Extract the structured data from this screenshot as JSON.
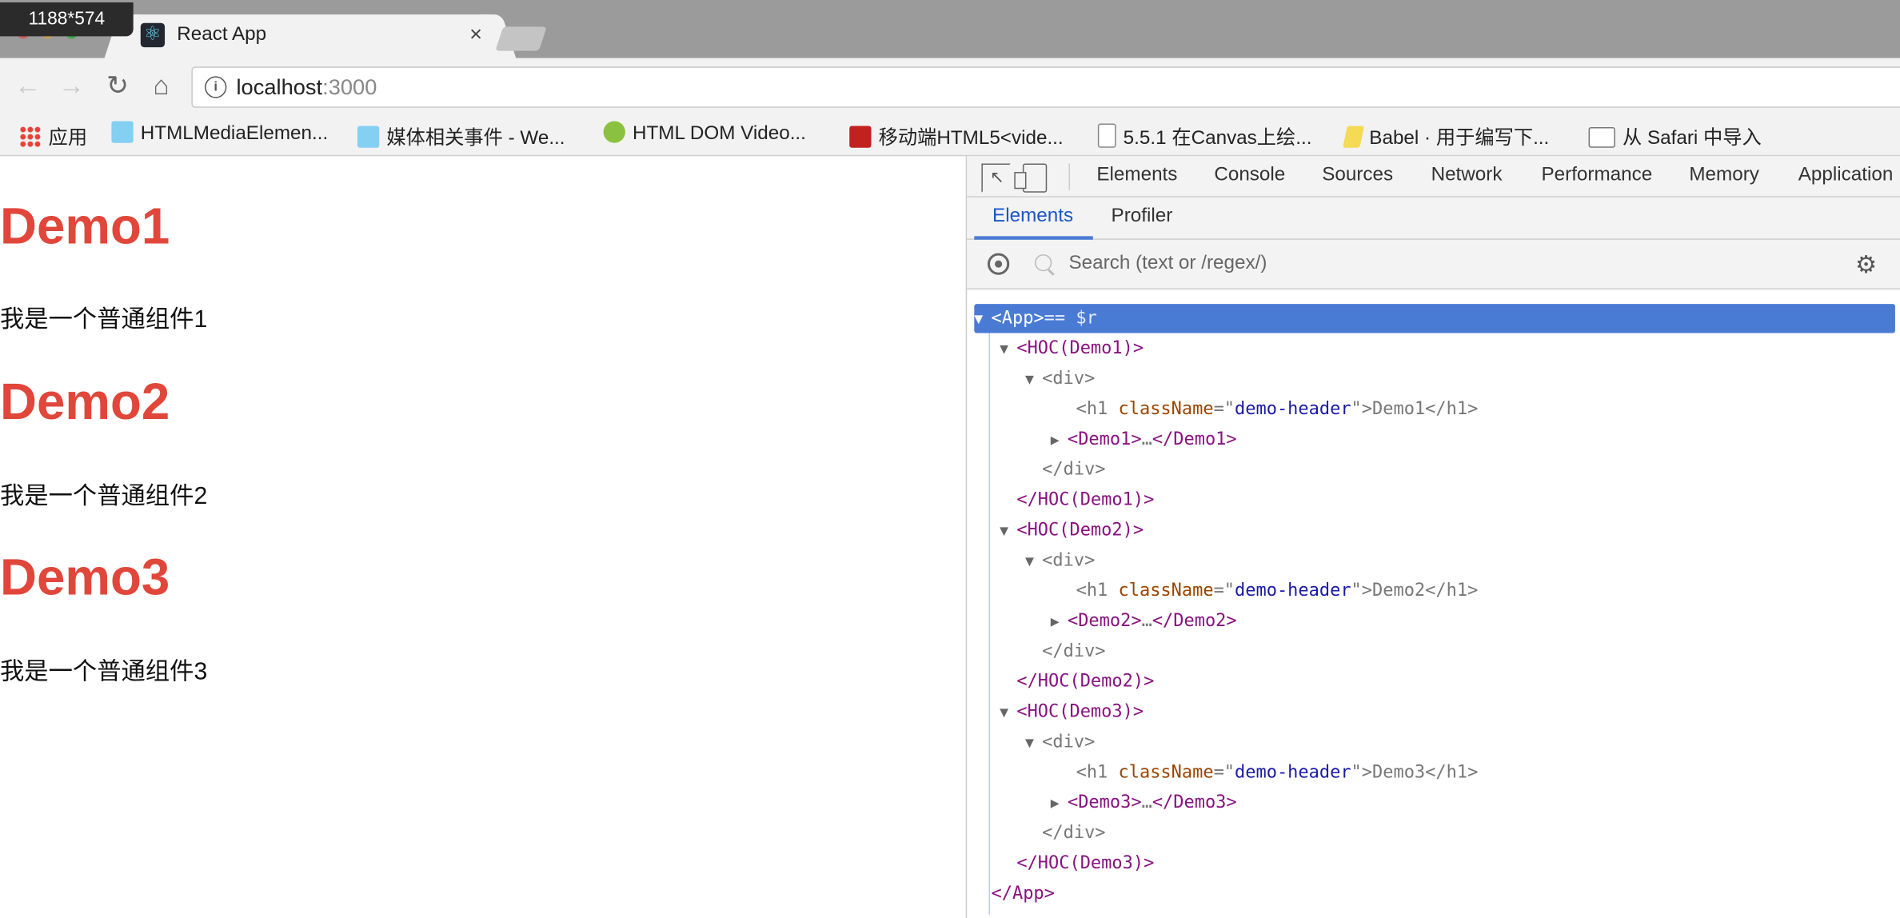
{
  "badge": "1188*574",
  "tab": {
    "title": "React App",
    "close": "×"
  },
  "nav": {
    "back": "←",
    "forward": "→",
    "reload": "↻",
    "home": "⌂"
  },
  "address": {
    "host": "localhost",
    "port": ":3000"
  },
  "bookmarks": [
    {
      "label": "应用",
      "icon": "apps-grid-icon",
      "color": "#e94335"
    },
    {
      "label": "HTMLMediaElemen...",
      "icon": "mdn-dino-icon",
      "color": "#83d0f2"
    },
    {
      "label": "媒体相关事件 - We...",
      "icon": "mdn-dino-icon",
      "color": "#83d0f2"
    },
    {
      "label": "HTML DOM Video...",
      "icon": "w3c-code-icon",
      "color": "#8ac13f"
    },
    {
      "label": "移动端HTML5<vide...",
      "icon": "csdn-icon",
      "color": "#c32020"
    },
    {
      "label": "5.5.1 在Canvas上绘...",
      "icon": "document-icon",
      "color": "#888888"
    },
    {
      "label": "Babel · 用于编写下...",
      "icon": "babel-icon",
      "color": "#f5da55"
    },
    {
      "label": "从 Safari 中导入",
      "icon": "folder-icon",
      "color": "#777777"
    }
  ],
  "page": {
    "items": [
      {
        "heading": "Demo1",
        "text": "我是一个普通组件1"
      },
      {
        "heading": "Demo2",
        "text": "我是一个普通组件2"
      },
      {
        "heading": "Demo3",
        "text": "我是一个普通组件3"
      }
    ]
  },
  "devtools": {
    "tabs": [
      "Elements",
      "Console",
      "Sources",
      "Network",
      "Performance",
      "Memory",
      "Application"
    ],
    "react_tabs": [
      "Elements",
      "Profiler"
    ],
    "search_placeholder": "Search (text or /regex/)",
    "tree": {
      "root_open": "<App>",
      "root_suffix": "== $r",
      "root_close": "</App>",
      "hocs": [
        {
          "open": "<HOC(Demo1)>",
          "div_open": "<div>",
          "h1_open": "<h1 ",
          "attr": "className",
          "eq": "=\"",
          "val": "demo-header",
          "h1_rest": "\">Demo1</h1>",
          "child_open": "<Demo1>",
          "ellipsis": "…",
          "child_close": "</Demo1>",
          "div_close": "</div>",
          "close": "</HOC(Demo1)>"
        },
        {
          "open": "<HOC(Demo2)>",
          "div_open": "<div>",
          "h1_open": "<h1 ",
          "attr": "className",
          "eq": "=\"",
          "val": "demo-header",
          "h1_rest": "\">Demo2</h1>",
          "child_open": "<Demo2>",
          "ellipsis": "…",
          "child_close": "</Demo2>",
          "div_close": "</div>",
          "close": "</HOC(Demo2)>"
        },
        {
          "open": "<HOC(Demo3)>",
          "div_open": "<div>",
          "h1_open": "<h1 ",
          "attr": "className",
          "eq": "=\"",
          "val": "demo-header",
          "h1_rest": "\">Demo3</h1>",
          "child_open": "<Demo3>",
          "ellipsis": "…",
          "child_close": "</Demo3>",
          "div_close": "</div>",
          "close": "</HOC(Demo3)>"
        }
      ]
    }
  },
  "colors": {
    "heading": "#e0473a",
    "selection": "#4a7bd4",
    "tag": "#881280",
    "attr": "#994500",
    "value": "#1a1aa6"
  }
}
